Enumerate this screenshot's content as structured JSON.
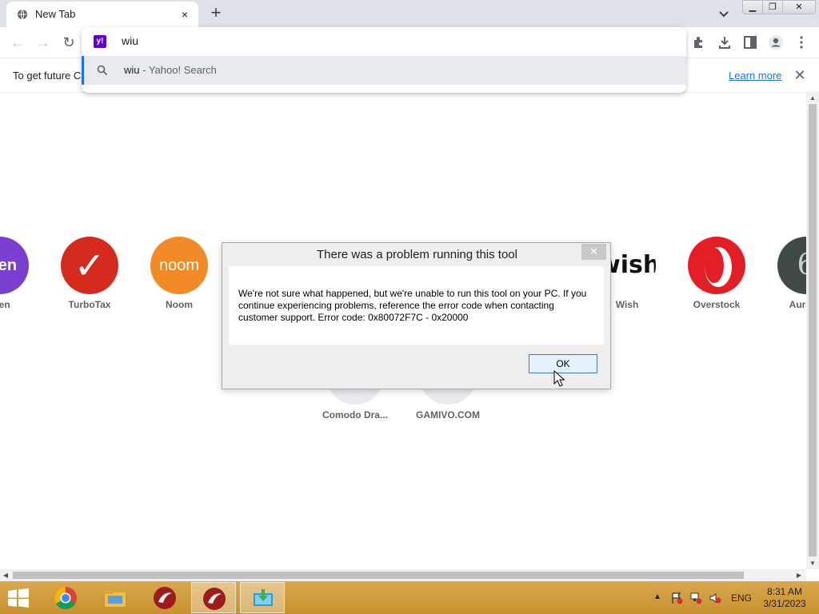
{
  "browser": {
    "tab": {
      "title": "New Tab",
      "close_glyph": "×"
    },
    "new_tab_glyph": "+",
    "window_buttons": {
      "minimize": "▁",
      "maximize": "❐",
      "close": "✕"
    },
    "nav": {
      "back": "←",
      "forward": "→",
      "reload": "↻"
    },
    "toolbar_icons": [
      "puzzle-extensions-icon",
      "download-icon",
      "side-panel-icon",
      "profile-icon",
      "more-menu-icon"
    ],
    "infobar": {
      "message": "To get future C",
      "learn_more": "Learn more",
      "close_glyph": "✕"
    }
  },
  "omnibox": {
    "input_value": "wiu",
    "logo_text": "y!",
    "suggestion": {
      "query": "wiu",
      "separator": " - ",
      "engine": "Yahoo! Search"
    }
  },
  "shortcuts": [
    {
      "label": "uten",
      "circle_text": "uten",
      "color": "#7a3fd0"
    },
    {
      "label": "TurboTax",
      "circle_text": "✓",
      "color": "#d52b1e"
    },
    {
      "label": "Noom",
      "circle_text": "noom",
      "color": "#f28a25"
    },
    {
      "label": "Wish",
      "circle_text": "wish",
      "color": "#ffffff"
    },
    {
      "label": "Overstock",
      "circle_text": "",
      "color": "#e41e26"
    },
    {
      "label": "Aurater",
      "circle_text": "6",
      "color": "#3e4a45"
    },
    {
      "label": "Comodo Dra...",
      "circle_text": "",
      "color": "#e8eaed"
    },
    {
      "label": "GAMIVO.COM",
      "circle_text": "",
      "color": "#e8eaed"
    }
  ],
  "dialog": {
    "title": "There was a problem running this tool",
    "close_glyph": "✕",
    "message": "We're not sure what happened, but we're unable to run this tool on your PC. If you continue experiencing problems, reference the error code when contacting customer support. Error code: 0x80072F7C - 0x20000",
    "ok_label": "OK"
  },
  "taskbar": {
    "apps": [
      "chrome-icon",
      "file-explorer-icon",
      "comodo-dragon-icon",
      "comodo-dragon-active-icon",
      "media-creation-tool-icon"
    ],
    "tray": {
      "arrow": "▲",
      "language": "ENG",
      "time": "8:31 AM",
      "date": "3/31/2023"
    },
    "colors": {
      "taskbar": "#c7922e",
      "accent": "#1a73e8"
    }
  }
}
